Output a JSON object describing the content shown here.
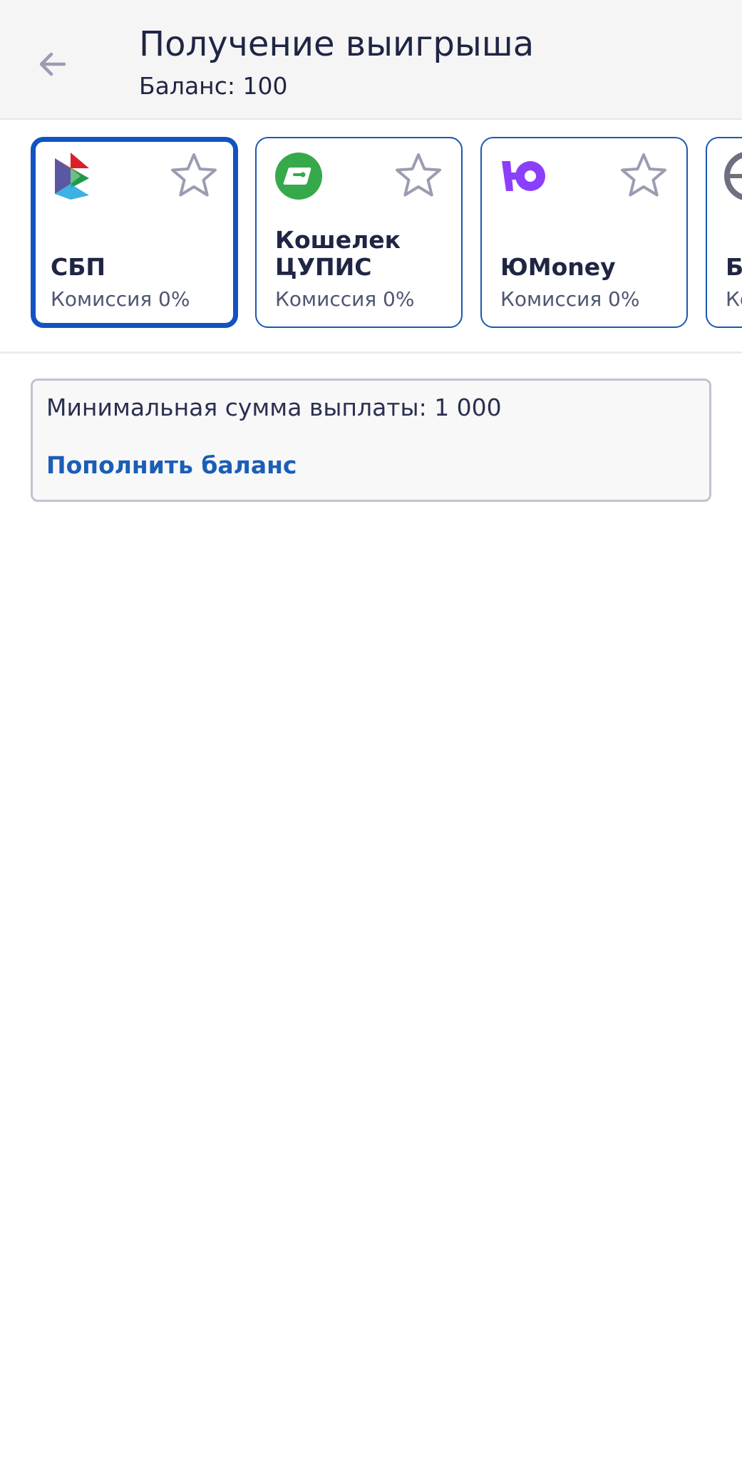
{
  "header": {
    "title": "Получение выигрыша",
    "balance": "Баланс: 100",
    "back_icon": "arrow-left-icon"
  },
  "methods": [
    {
      "name": "СБП",
      "fee": "Комиссия 0%",
      "icon": "sbp-logo-icon",
      "selected": true
    },
    {
      "name": "Кошелек ЦУПИС",
      "fee": "Комиссия 0%",
      "icon": "cupis-wallet-icon",
      "selected": false
    },
    {
      "name": "ЮMoney",
      "fee": "Комиссия 0%",
      "icon": "yumoney-logo-icon",
      "selected": false
    },
    {
      "name": "Б п",
      "fee": "Ко",
      "icon": "bank-card-icon",
      "selected": false
    }
  ],
  "info": {
    "min_sum": "Минимальная сумма выплаты: 1 000",
    "topup_link": "Пополнить баланс"
  },
  "colors": {
    "accent": "#1153c0",
    "text": "#1f2544",
    "link": "#1b5eb6",
    "header_bg": "#f5f5f5"
  }
}
